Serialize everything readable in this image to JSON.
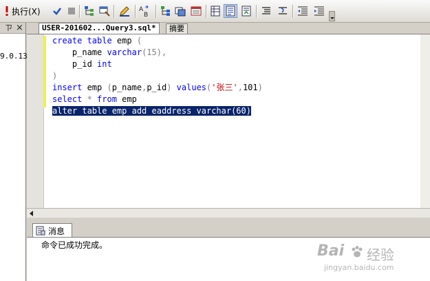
{
  "toolbar": {
    "execute_label": "执行(X)"
  },
  "left_panel": {
    "pin_label": "ㄗ",
    "close_label": "×",
    "server_text": "9.0.13"
  },
  "doc_tabs": [
    {
      "label": "USER-201602...Query3.sql*",
      "active": true
    },
    {
      "label": "摘要",
      "active": false
    }
  ],
  "editor": {
    "lines": [
      {
        "parts": [
          [
            "kw",
            "create table "
          ],
          [
            "",
            "emp "
          ],
          [
            "gray",
            "("
          ]
        ]
      },
      {
        "parts": [
          [
            "",
            "    p_name "
          ],
          [
            "kw",
            "varchar"
          ],
          [
            "gray",
            "(15),"
          ]
        ]
      },
      {
        "parts": [
          [
            "",
            "    p_id "
          ],
          [
            "kw",
            "int"
          ]
        ]
      },
      {
        "parts": [
          [
            "gray",
            ")"
          ]
        ]
      },
      {
        "parts": [
          [
            "kw",
            "insert "
          ],
          [
            "",
            "emp "
          ],
          [
            "gray",
            "("
          ],
          [
            "",
            "p_name"
          ],
          [
            "gray",
            ","
          ],
          [
            "",
            "p_id"
          ],
          [
            "gray",
            ") "
          ],
          [
            "kw",
            "values"
          ],
          [
            "gray",
            "("
          ],
          [
            "str",
            "'张三'"
          ],
          [
            "gray",
            ","
          ],
          [
            "",
            "101"
          ],
          [
            "gray",
            ")"
          ]
        ]
      },
      {
        "parts": [
          [
            "kw",
            "select "
          ],
          [
            "gray",
            "* "
          ],
          [
            "kw",
            "from "
          ],
          [
            "",
            "emp"
          ]
        ]
      },
      {
        "selected": true,
        "parts": [
          [
            "",
            "alter table emp add eaddress varchar(60)"
          ]
        ]
      }
    ]
  },
  "results": {
    "tab_label": "消息",
    "message": "命令已成功完成。"
  },
  "watermark": {
    "brand": "Bai",
    "brand_cn": "经验",
    "url": "jingyan.baidu.com"
  }
}
